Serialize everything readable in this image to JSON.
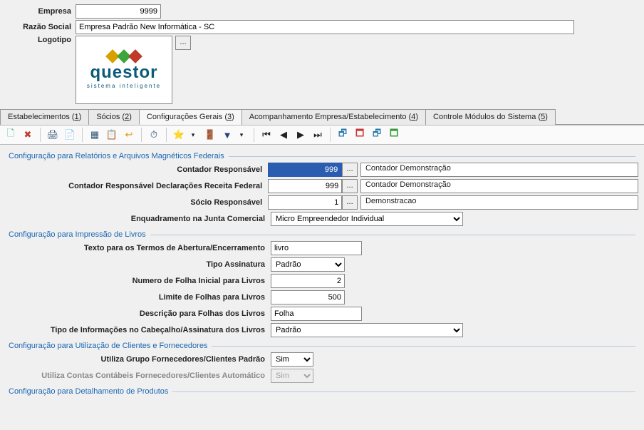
{
  "header": {
    "empresa_label": "Empresa",
    "empresa_code": "9999",
    "razao_label": "Razão Social",
    "razao_value": "Empresa Padrão New Informática - SC",
    "logotipo_label": "Logotipo",
    "logo_word": "questor",
    "logo_sub": "sistema inteligente"
  },
  "tabs": {
    "t0": "Estabelecimentos (",
    "t0u": "1",
    "t0e": ")",
    "t1": "Sócios (",
    "t1u": "2",
    "t1e": ")",
    "t2": "Configurações Gerais (",
    "t2u": "3",
    "t2e": ")",
    "t3": "Acompanhamento Empresa/Estabelecimento (",
    "t3u": "4",
    "t3e": ")",
    "t4": "Controle Módulos do Sistema (",
    "t4u": "5",
    "t4e": ")"
  },
  "toolbar": {
    "new": "🗋",
    "del": "✖",
    "print": "🖨",
    "copy": "📄",
    "grid": "▦",
    "table": "📋",
    "exit": "↩",
    "clock": "⏱",
    "star": "⭐",
    "star_dd": "▾",
    "exit2": "🚪",
    "funnel": "▼",
    "funnel_dd": "▾",
    "first": "⏮",
    "prev": "◀",
    "next": "▶",
    "last": "⏭",
    "win1": "🗗",
    "win2": "🗖",
    "win3": "🗗",
    "win4": "🗖"
  },
  "sections": {
    "s1": "Configuração para Relatórios e Arquivos Magnéticos Federais",
    "s2": "Configuração para Impressão de Livros",
    "s3": "Configuração para Utilização de Clientes e Fornecedores",
    "s4": "Configuração para Detalhamento de Produtos"
  },
  "f": {
    "contador_lbl": "Contador Responsável",
    "contador_val": "999",
    "contador_desc": "Contador Demonstração",
    "contador_rf_lbl": "Contador Responsável Declarações Receita Federal",
    "contador_rf_val": "999",
    "contador_rf_desc": "Contador Demonstração",
    "socio_lbl": "Sócio Responsável",
    "socio_val": "1",
    "socio_desc": "Demonstracao",
    "enquad_lbl": "Enquadramento na Junta Comercial",
    "enquad_val": "Micro Empreendedor Individual",
    "texto_lbl": "Texto para os Termos de Abertura/Encerramento",
    "texto_val": "livro",
    "tipoass_lbl": "Tipo Assinatura",
    "tipoass_val": "Padrão",
    "numfolha_lbl": "Numero de Folha Inicial para Livros",
    "numfolha_val": "2",
    "limite_lbl": "Limite de Folhas para Livros",
    "limite_val": "500",
    "descfolha_lbl": "Descrição para Folhas dos Livros",
    "descfolha_val": "Folha",
    "tipoinfo_lbl": "Tipo de Informações no Cabeçalho/Assinatura dos Livros",
    "tipoinfo_val": "Padrão",
    "grupo_lbl": "Utiliza Grupo Fornecedores/Clientes Padrão",
    "grupo_val": "Sim",
    "contas_lbl": "Utiliza Contas Contábeis Fornecedores/Clientes Automático",
    "contas_val": "Sim"
  },
  "glyph": {
    "dots": "..."
  }
}
